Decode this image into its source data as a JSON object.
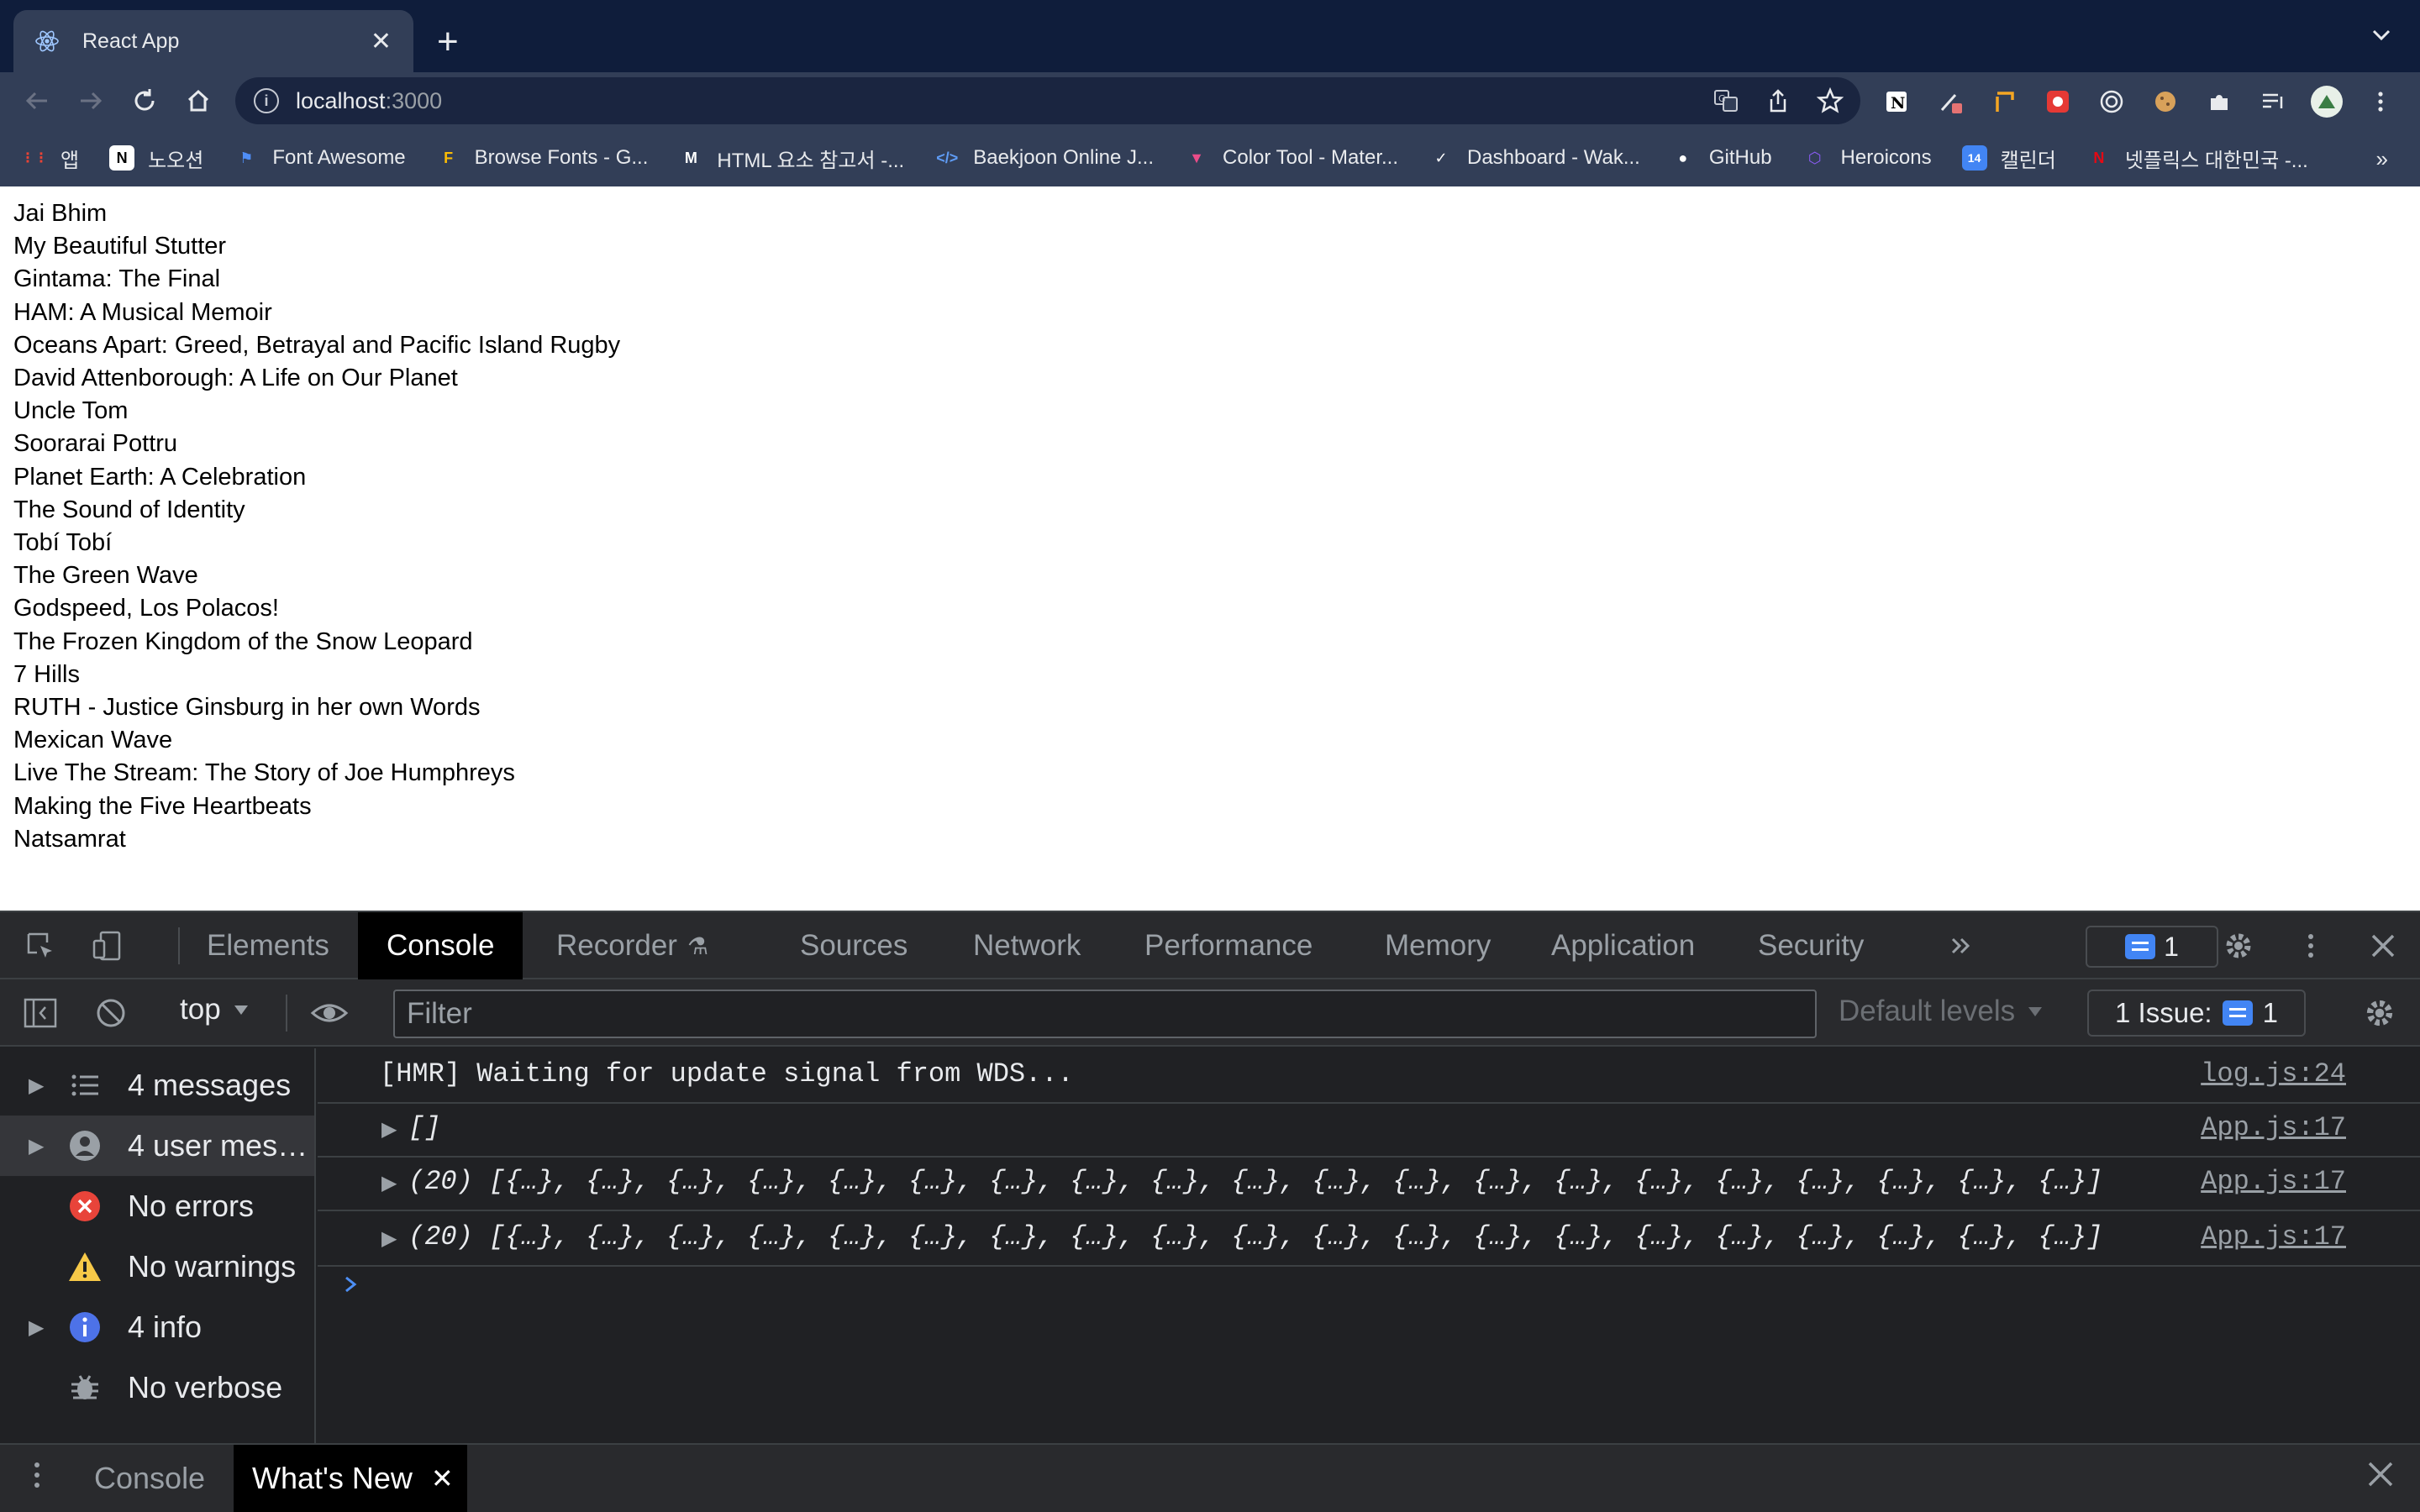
{
  "browser": {
    "tab_title": "React App",
    "url_host": "localhost",
    "url_port": ":3000",
    "bookmarks": [
      {
        "label": "앱",
        "icon": "apps-grid-icon",
        "color": "#ea4335"
      },
      {
        "label": "노오션",
        "icon": "notion-icon",
        "color": "#ffffff"
      },
      {
        "label": "Font Awesome",
        "icon": "flag-icon",
        "color": "#4f8ef7"
      },
      {
        "label": "Browse Fonts - G...",
        "icon": "google-fonts-icon",
        "color": "#fbbc04"
      },
      {
        "label": "HTML 요소 참고서 -...",
        "icon": "mdn-icon",
        "color": "#ffffff"
      },
      {
        "label": "Baekjoon Online J...",
        "icon": "code-icon",
        "color": "#5f9cf5"
      },
      {
        "label": "Color Tool - Mater...",
        "icon": "material-icon",
        "color": "#ea4c89"
      },
      {
        "label": "Dashboard - Wak...",
        "icon": "check-circle-icon",
        "color": "#ffffff"
      },
      {
        "label": "GitHub",
        "icon": "github-icon",
        "color": "#ffffff"
      },
      {
        "label": "Heroicons",
        "icon": "shield-icon",
        "color": "#8b5cf6"
      },
      {
        "label": "캘린더",
        "icon": "calendar-icon",
        "color": "#4285f4"
      },
      {
        "label": "넷플릭스 대한민국 -...",
        "icon": "netflix-icon",
        "color": "#e50914"
      }
    ]
  },
  "page": {
    "movies": [
      "Jai Bhim",
      "My Beautiful Stutter",
      "Gintama: The Final",
      "HAM: A Musical Memoir",
      "Oceans Apart: Greed, Betrayal and Pacific Island Rugby",
      "David Attenborough: A Life on Our Planet",
      "Uncle Tom",
      "Soorarai Pottru",
      "Planet Earth: A Celebration",
      "The Sound of Identity",
      "Tobí Tobí",
      "The Green Wave",
      "Godspeed, Los Polacos!",
      "The Frozen Kingdom of the Snow Leopard",
      "7 Hills",
      "RUTH - Justice Ginsburg in her own Words",
      "Mexican Wave",
      "Live The Stream: The Story of Joe Humphreys",
      "Making the Five Heartbeats",
      "Natsamrat"
    ]
  },
  "devtools": {
    "tabs": [
      "Elements",
      "Console",
      "Recorder",
      "Sources",
      "Network",
      "Performance",
      "Memory",
      "Application",
      "Security"
    ],
    "active_tab": "Console",
    "issues_count": "1",
    "context": "top",
    "filter_placeholder": "Filter",
    "levels": "Default levels",
    "issues_label": "1 Issue:",
    "issues_label_count": "1",
    "sidebar": [
      {
        "label": "4 messages",
        "icon": "list-icon",
        "expandable": true
      },
      {
        "label": "4 user mes…",
        "icon": "user-icon",
        "expandable": true
      },
      {
        "label": "No errors",
        "icon": "error-icon",
        "expandable": false
      },
      {
        "label": "No warnings",
        "icon": "warning-icon",
        "expandable": false
      },
      {
        "label": "4 info",
        "icon": "info-icon",
        "expandable": true
      },
      {
        "label": "No verbose",
        "icon": "bug-icon",
        "expandable": false
      }
    ],
    "logs": [
      {
        "text": "[HMR] Waiting for update signal from WDS...",
        "source": "log.js:24",
        "expandable": false
      },
      {
        "text": "[]",
        "source": "App.js:17",
        "expandable": true
      },
      {
        "text": "(20) [{…}, {…}, {…}, {…}, {…}, {…}, {…}, {…}, {…}, {…}, {…}, {…}, {…}, {…}, {…}, {…}, {…}, {…}, {…}, {…}]",
        "source": "App.js:17",
        "expandable": true
      },
      {
        "text": "(20) [{…}, {…}, {…}, {…}, {…}, {…}, {…}, {…}, {…}, {…}, {…}, {…}, {…}, {…}, {…}, {…}, {…}, {…}, {…}, {…}]",
        "source": "App.js:17",
        "expandable": true
      }
    ],
    "drawer_tabs": [
      "Console",
      "What's New"
    ],
    "drawer_active": "What's New"
  }
}
